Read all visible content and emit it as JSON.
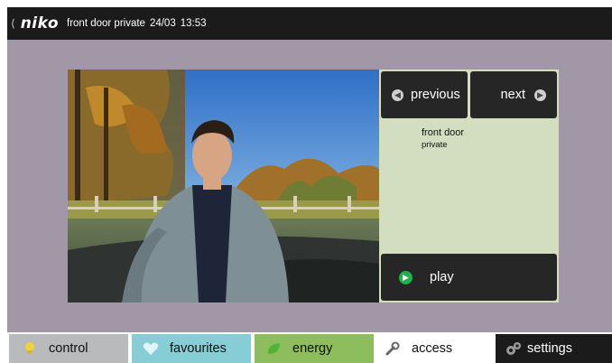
{
  "header": {
    "back_icon": "chevron-left-icon",
    "logo": "niko",
    "title": "front door private",
    "date": "24/03",
    "time": "13:53"
  },
  "intercom": {
    "previous_label": "previous",
    "next_label": "next",
    "play_label": "play",
    "camera_name_line1": "front door",
    "camera_name_line2": "private"
  },
  "tabs": [
    {
      "label": "control",
      "icon": "lightbulb-icon",
      "color": "#b9babb"
    },
    {
      "label": "favourites",
      "icon": "heart-icon",
      "color": "#86cdd5"
    },
    {
      "label": "energy",
      "icon": "leaf-icon",
      "color": "#8dbd5c"
    },
    {
      "label": "access",
      "icon": "wrench-icon",
      "color": "#ffffff"
    },
    {
      "label": "settings",
      "icon": "gears-icon",
      "color": "#1b1b1b"
    }
  ],
  "colors": {
    "stage_background": "#a197a7",
    "panel_background": "#d3dec1",
    "button_dark": "#262626",
    "play_green": "#22b04a"
  }
}
